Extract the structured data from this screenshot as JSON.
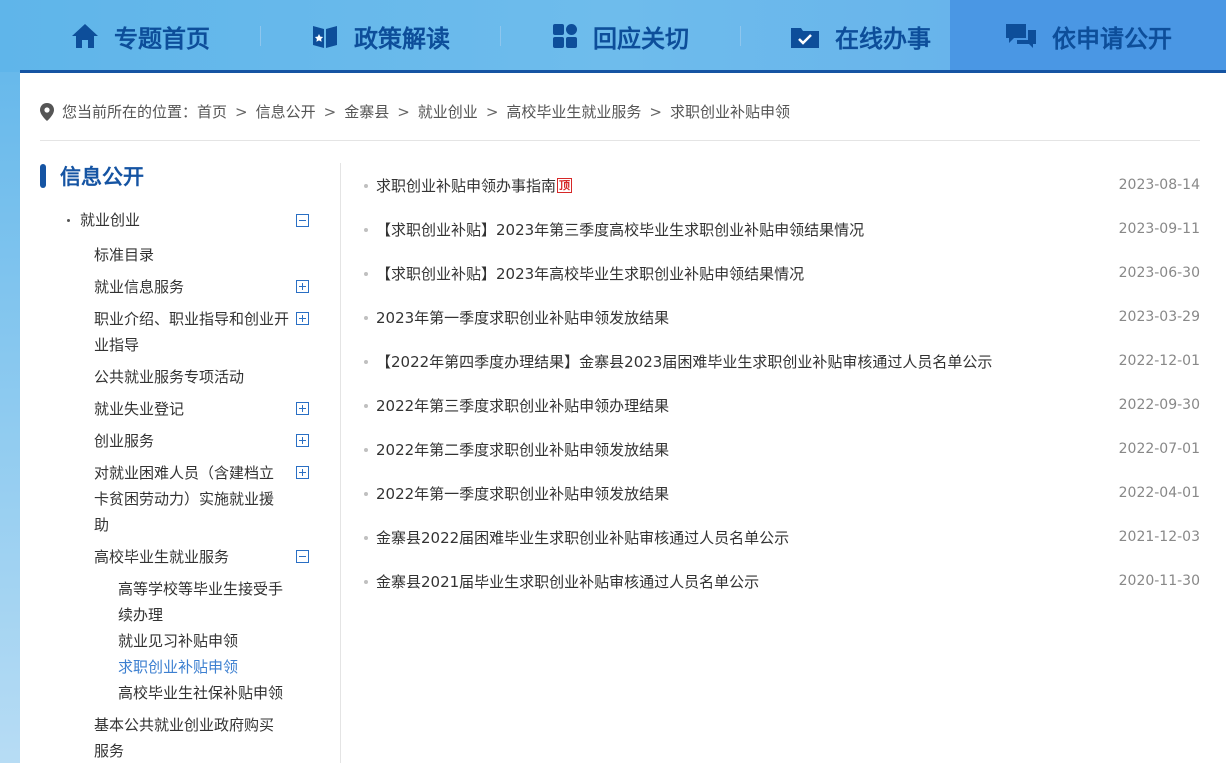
{
  "nav": {
    "items": [
      {
        "label": "专题首页",
        "icon": "home-icon"
      },
      {
        "label": "政策解读",
        "icon": "book-icon"
      },
      {
        "label": "回应关切",
        "icon": "grid-icon"
      },
      {
        "label": "在线办事",
        "icon": "folder-check-icon"
      },
      {
        "label": "依申请公开",
        "icon": "chat-icon"
      }
    ]
  },
  "breadcrumb": {
    "prefix": "您当前所在的位置：",
    "items": [
      "首页",
      "信息公开",
      "金寨县",
      "就业创业",
      "高校毕业生就业服务",
      "求职创业补贴申领"
    ]
  },
  "sidebar": {
    "title": "信息公开",
    "root": "就业创业",
    "items": [
      "标准目录",
      "就业信息服务",
      "职业介绍、职业指导和创业开业指导",
      "公共就业服务专项活动",
      "就业失业登记",
      "创业服务",
      "对就业困难人员（含建档立卡贫困劳动力）实施就业援助",
      "高校毕业生就业服务",
      "基本公共就业创业政府购买服务"
    ],
    "subitems": [
      "高等学校等毕业生接受手续办理",
      "就业见习补贴申领",
      "求职创业补贴申领",
      "高校毕业生社保补贴申领"
    ]
  },
  "articles": [
    {
      "title": "求职创业补贴申领办事指南",
      "badge": "顶",
      "date": "2023-08-14"
    },
    {
      "title": "【求职创业补贴】2023年第三季度高校毕业生求职创业补贴申领结果情况",
      "date": "2023-09-11"
    },
    {
      "title": "【求职创业补贴】2023年高校毕业生求职创业补贴申领结果情况",
      "date": "2023-06-30"
    },
    {
      "title": "2023年第一季度求职创业补贴申领发放结果",
      "date": "2023-03-29"
    },
    {
      "title": "【2022年第四季度办理结果】金寨县2023届困难毕业生求职创业补贴审核通过人员名单公示",
      "date": "2022-12-01"
    },
    {
      "title": "2022年第三季度求职创业补贴申领办理结果",
      "date": "2022-09-30"
    },
    {
      "title": "2022年第二季度求职创业补贴申领发放结果",
      "date": "2022-07-01"
    },
    {
      "title": "2022年第一季度求职创业补贴申领发放结果",
      "date": "2022-04-01"
    },
    {
      "title": "金寨县2022届困难毕业生求职创业补贴审核通过人员名单公示",
      "date": "2021-12-03"
    },
    {
      "title": "金寨县2021届毕业生求职创业补贴审核通过人员名单公示",
      "date": "2020-11-30"
    }
  ],
  "colors": {
    "accent": "#1554a3",
    "nav_text": "#0d4e9a",
    "active_link": "#3c7fd0",
    "badge": "#d62828"
  }
}
